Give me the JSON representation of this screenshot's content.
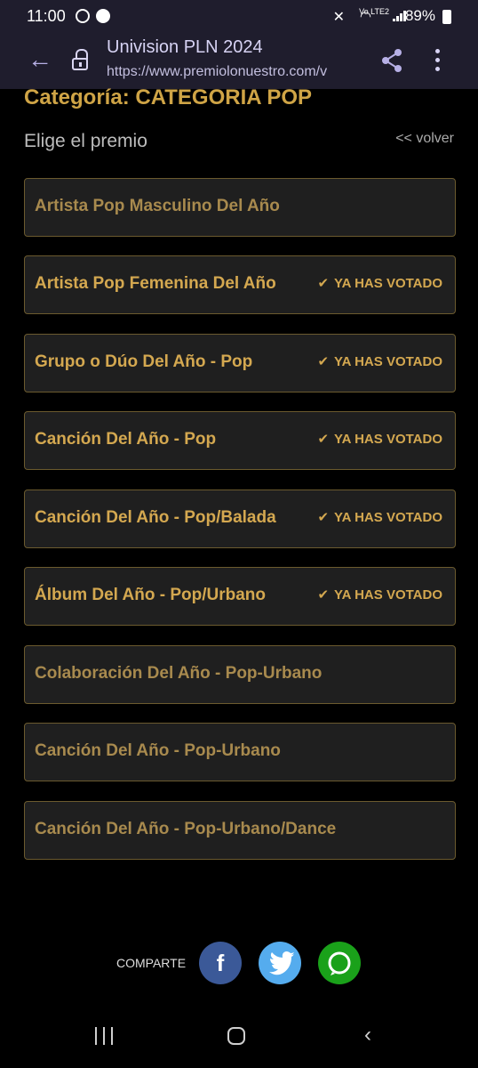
{
  "status_bar": {
    "time": "11:00",
    "battery": "89%",
    "network": "Vo LTE2"
  },
  "browser": {
    "title": "Univision PLN 2024",
    "url": "https://www.premiolonuestro.com/v"
  },
  "page": {
    "category_title": "Categoría: CATEGORIA POP",
    "subtitle": "Elige el premio",
    "back_link": "<< volver"
  },
  "awards": [
    {
      "name": "Artista Pop Masculino Del Año",
      "voted": ""
    },
    {
      "name": "Artista Pop Femenina Del Año",
      "voted": "YA HAS VOTADO"
    },
    {
      "name": "Grupo o Dúo Del Año - Pop",
      "voted": "YA HAS VOTADO"
    },
    {
      "name": "Canción Del Año - Pop",
      "voted": "YA HAS VOTADO"
    },
    {
      "name": "Canción Del Año - Pop/Balada",
      "voted": "YA HAS VOTADO"
    },
    {
      "name": "Álbum Del Año - Pop/Urbano",
      "voted": "YA HAS VOTADO"
    },
    {
      "name": "Colaboración Del Año - Pop-Urbano",
      "voted": ""
    },
    {
      "name": "Canción Del Año - Pop-Urbano",
      "voted": ""
    },
    {
      "name": "Canción Del Año - Pop-Urbano/Dance",
      "voted": ""
    }
  ],
  "share": {
    "label": "COMPARTE",
    "colors": {
      "facebook": "#3b5998",
      "twitter": "#55acee",
      "whatsapp": "#1aa11a"
    }
  },
  "accent_color": "#d4a850"
}
